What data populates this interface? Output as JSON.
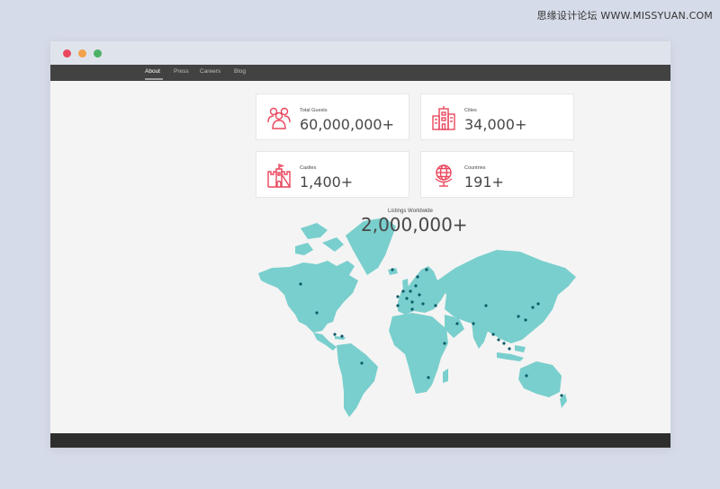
{
  "watermark": "思缘设计论坛 WWW.MISSYUAN.COM",
  "nav": [
    {
      "label": "About",
      "active": true
    },
    {
      "label": "Press",
      "active": false
    },
    {
      "label": "Careers",
      "active": false
    },
    {
      "label": "Blog",
      "active": false
    }
  ],
  "stats": [
    {
      "label": "Total Guests",
      "value": "60,000,000+",
      "icon": "people-icon"
    },
    {
      "label": "Cities",
      "value": "34,000+",
      "icon": "city-icon"
    },
    {
      "label": "Castles",
      "value": "1,400+",
      "icon": "castle-icon"
    },
    {
      "label": "Countries",
      "value": "191+",
      "icon": "globe-icon"
    }
  ],
  "listings": {
    "label": "Listings Worldwide",
    "value": "2,000,000+"
  },
  "colors": {
    "accent": "#e9475d",
    "map": "#79cfcd",
    "marker": "#0c5c68",
    "navbar": "#424242",
    "footer": "#2e2e2e"
  }
}
